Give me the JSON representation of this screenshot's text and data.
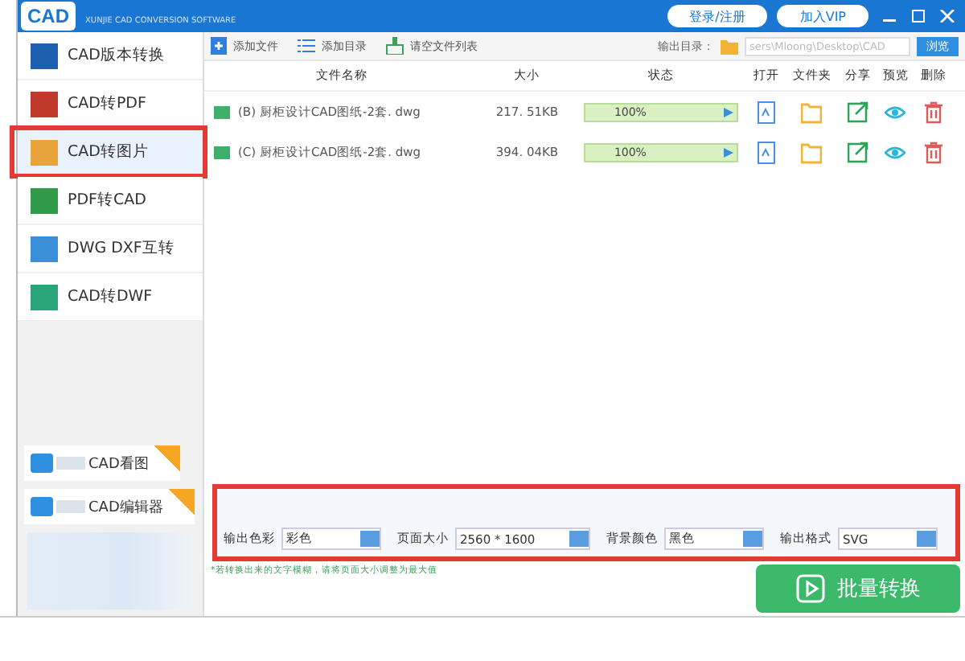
{
  "header": {
    "logo": "CAD",
    "subtitle": "XUNJIE CAD CONVERSION SOFTWARE",
    "login": "登录/注册",
    "vip": "加入VIP"
  },
  "sidebar": {
    "items": [
      {
        "label": "CAD版本转换",
        "selected": false,
        "color": "#1f5fb0"
      },
      {
        "label": "CAD转PDF",
        "selected": false,
        "color": "#c0392b"
      },
      {
        "label": "CAD转图片",
        "selected": true,
        "color": "#e8a33a"
      },
      {
        "label": "PDF转CAD",
        "selected": false,
        "color": "#2e9a4a"
      },
      {
        "label": "DWG DXF互转",
        "selected": false,
        "color": "#3a8fd8"
      },
      {
        "label": "CAD转DWF",
        "selected": false,
        "color": "#2aa57a"
      }
    ],
    "promos": [
      {
        "label": "CAD看图"
      },
      {
        "label": "CAD编辑器"
      }
    ]
  },
  "toolbar": {
    "add_file": "添加文件",
    "add_folder": "添加目录",
    "clear": "请空文件列表",
    "output_label": "输出目录：",
    "output_path": "sers\\Mloong\\Desktop\\CAD",
    "browse": "浏览"
  },
  "table": {
    "columns": [
      "文件名称",
      "大小",
      "状态",
      "打开",
      "文件夹",
      "分享",
      "预览",
      "删除"
    ],
    "rows": [
      {
        "name": "(B) 厨柜设计CAD图纸-2套. dwg",
        "size": "217. 51KB",
        "status": "100%",
        "level": 1
      },
      {
        "name": "(C) 厨柜设计CAD图纸-2套. dwg",
        "size": "394. 04KB",
        "status": "100%",
        "level": 1
      }
    ]
  },
  "settings": [
    {
      "label": "输出色彩",
      "value": "彩色"
    },
    {
      "label": "页面大小",
      "value": "2560 * 1600"
    },
    {
      "label": "背景颜色",
      "value": "黑色"
    },
    {
      "label": "输出格式",
      "value": "SVG"
    }
  ],
  "note": "*若转换出来的文字模糊，请将页面大小调整为最大值",
  "convert_button": "批量转换"
}
